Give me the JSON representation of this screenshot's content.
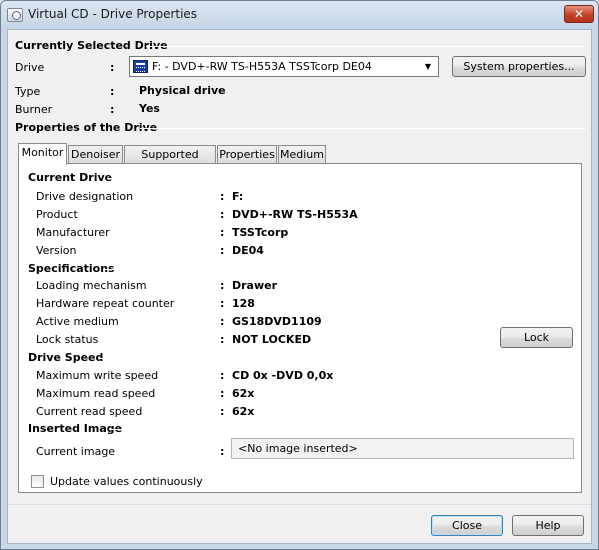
{
  "window": {
    "title": "Virtual CD - Drive Properties",
    "close_glyph": "✕"
  },
  "selected": {
    "heading": "Currently Selected Drive",
    "drive_label": "Drive",
    "drive_value": "F: - DVD+-RW TS-H553A TSSTcorp DE04",
    "type_label": "Type",
    "type_value": "Physical drive",
    "burner_label": "Burner",
    "burner_value": "Yes",
    "system_button": "System properties...",
    "colon": ":"
  },
  "properties": {
    "heading": "Properties of the Drive",
    "tabs": [
      "Monitor",
      "Denoiser",
      "Supported Media",
      "Properties",
      "Medium"
    ],
    "active_tab": "Monitor"
  },
  "monitor": {
    "current_drive": {
      "heading": "Current Drive",
      "rows": [
        {
          "label": "Drive designation",
          "value": "F:"
        },
        {
          "label": "Product",
          "value": "DVD+-RW TS-H553A"
        },
        {
          "label": "Manufacturer",
          "value": "TSSTcorp"
        },
        {
          "label": "Version",
          "value": "DE04"
        }
      ]
    },
    "specifications": {
      "heading": "Specifications",
      "rows": [
        {
          "label": "Loading mechanism",
          "value": "Drawer"
        },
        {
          "label": "Hardware repeat counter",
          "value": "128"
        },
        {
          "label": "Active medium",
          "value": "GS18DVD1109"
        },
        {
          "label": "Lock status",
          "value": "NOT LOCKED"
        }
      ],
      "lock_button": "Lock"
    },
    "drive_speed": {
      "heading": "Drive Speed",
      "rows": [
        {
          "label": "Maximum write speed",
          "value": "CD 0x -DVD 0,0x"
        },
        {
          "label": "Maximum read speed",
          "value": "62x"
        },
        {
          "label": "Current read speed",
          "value": "62x"
        }
      ]
    },
    "inserted_image": {
      "heading": "Inserted Image",
      "label": "Current image",
      "value": "<No image inserted>"
    },
    "update_checkbox": {
      "label": "Update values continuously",
      "checked": false
    }
  },
  "footer": {
    "close_button": "Close",
    "help_button": "Help"
  }
}
